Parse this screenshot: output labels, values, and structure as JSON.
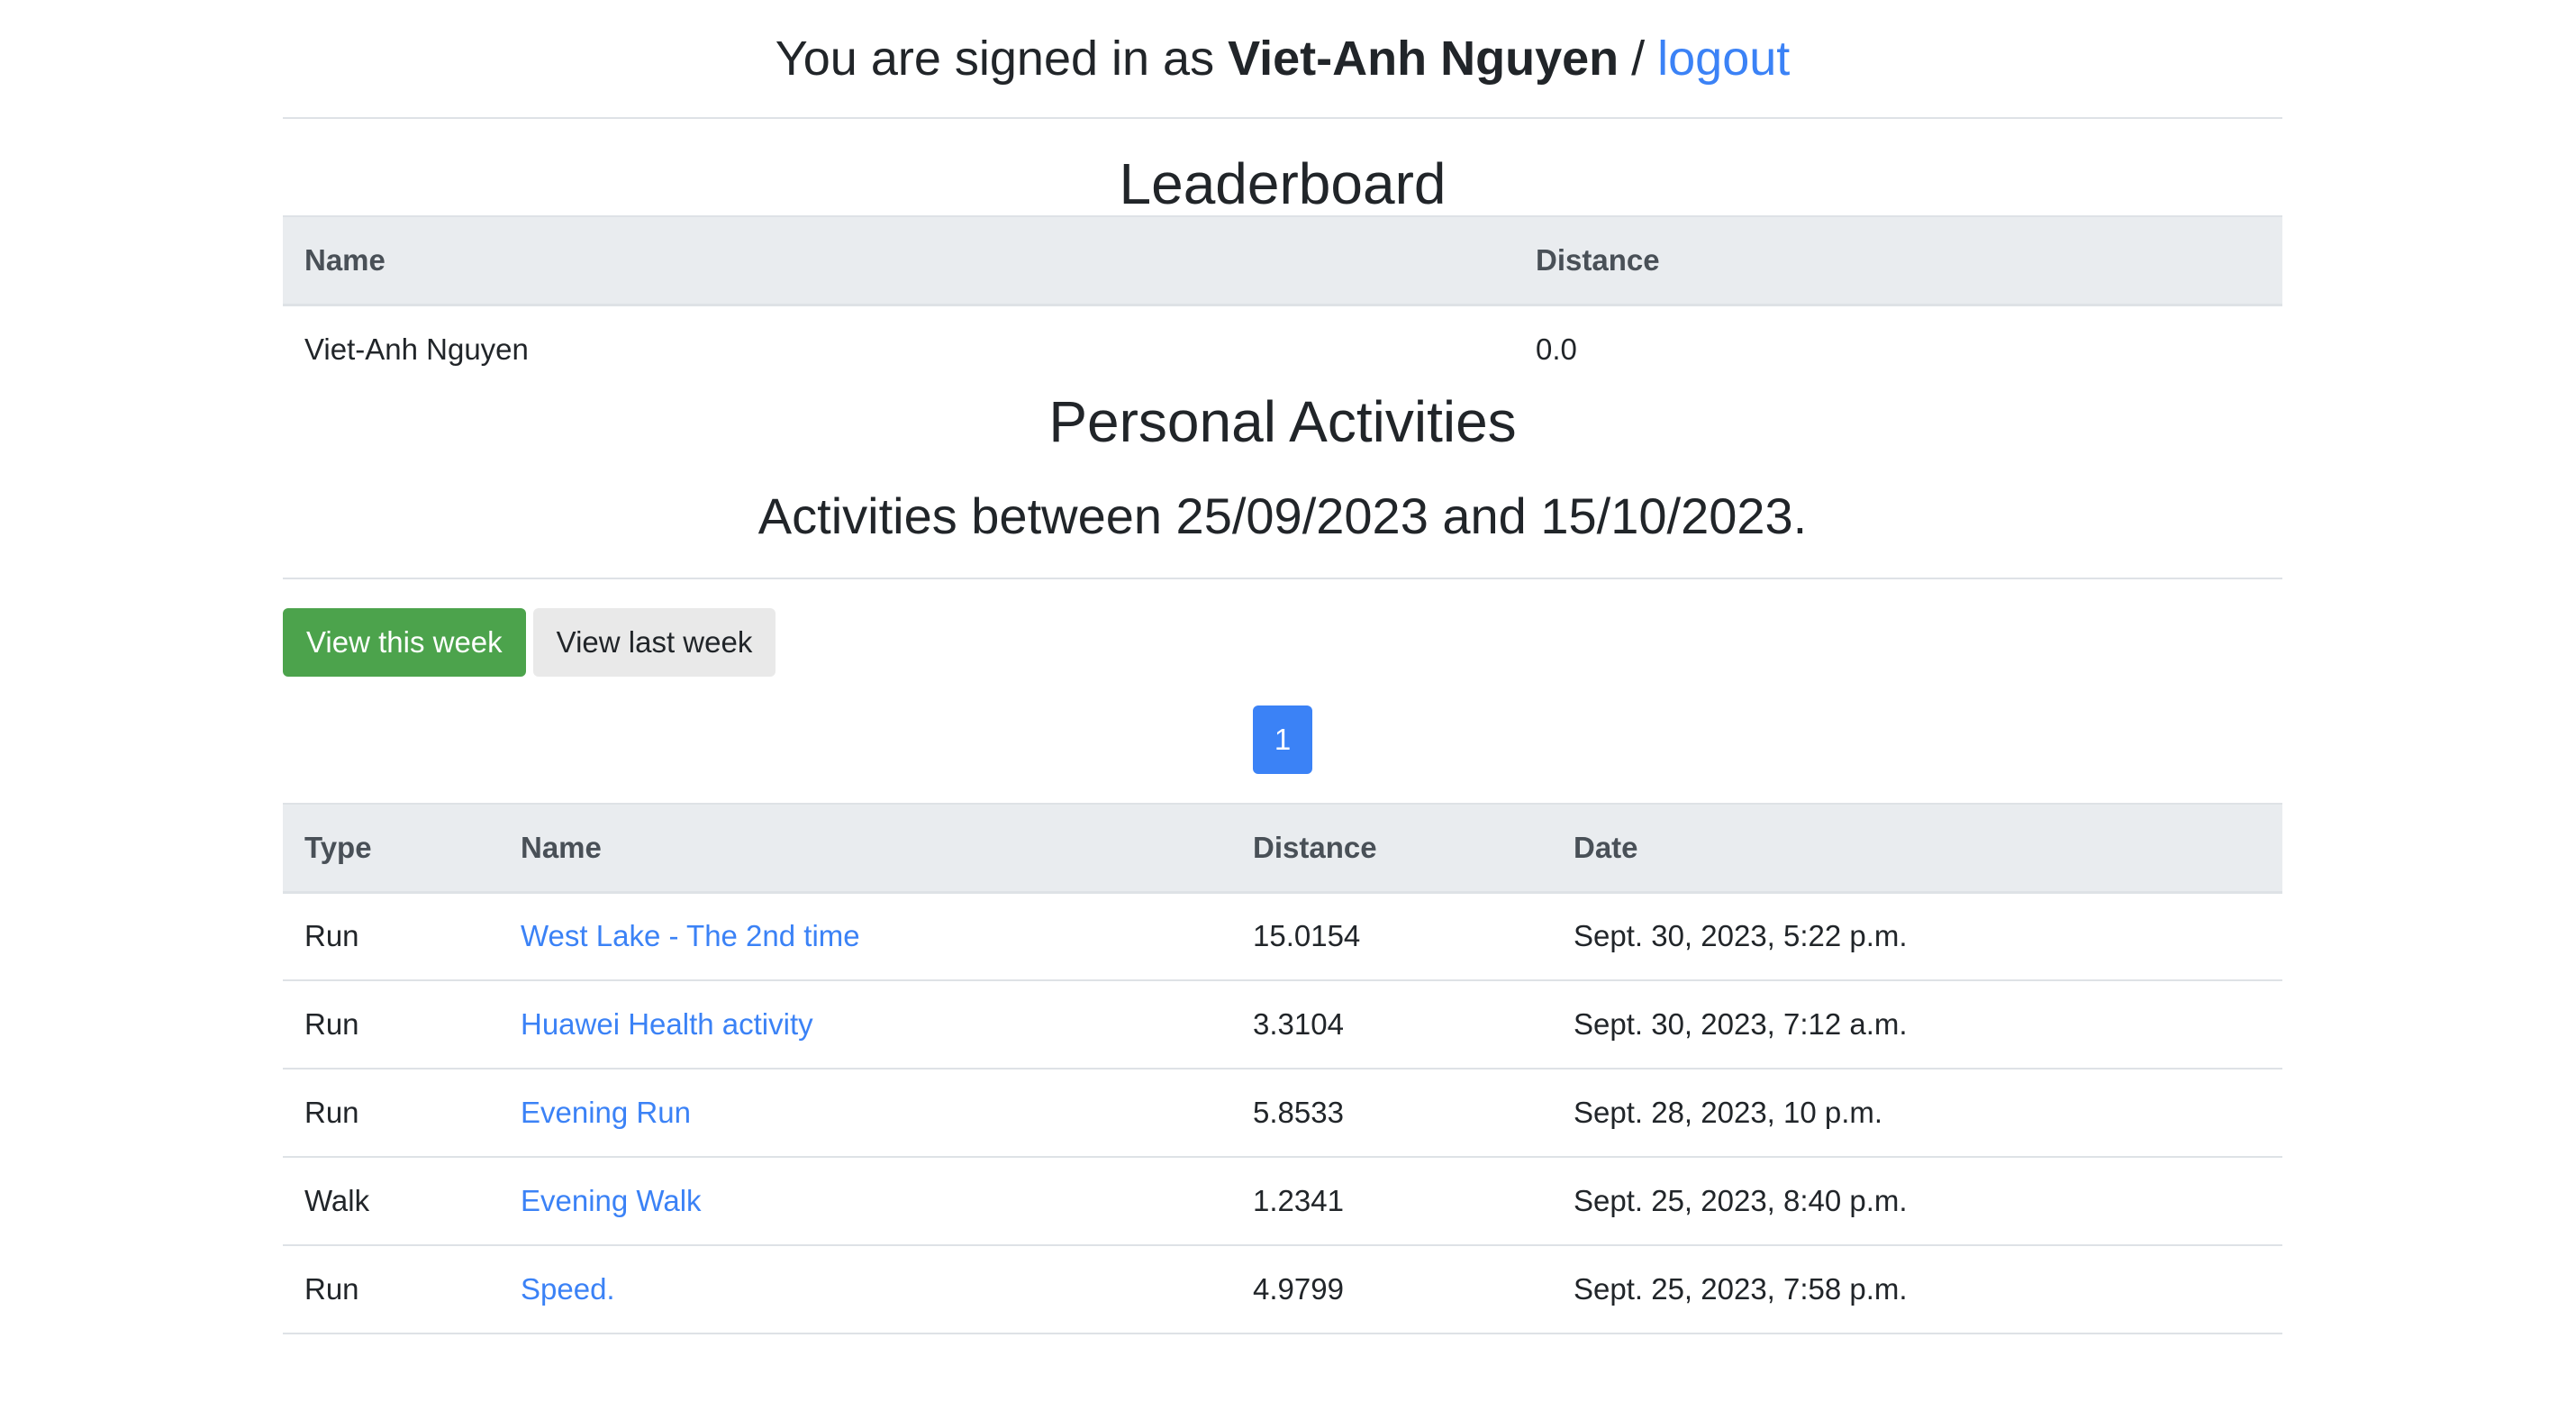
{
  "header": {
    "signed_in_prefix": "You are signed in as",
    "username": "Viet-Anh Nguyen",
    "separator": "/",
    "logout_label": "logout"
  },
  "leaderboard": {
    "title": "Leaderboard",
    "columns": [
      "Name",
      "Distance"
    ],
    "rows": [
      {
        "name": "Viet-Anh Nguyen",
        "distance": "0.0"
      }
    ]
  },
  "personal": {
    "title": "Personal Activities",
    "range_text": "Activities between 25/09/2023 and 15/10/2023.",
    "buttons": {
      "this_week": "View this week",
      "last_week": "View last week"
    },
    "pagination": {
      "current_page": "1"
    },
    "columns": [
      "Type",
      "Name",
      "Distance",
      "Date"
    ],
    "rows": [
      {
        "type": "Run",
        "name": "West Lake - The 2nd time",
        "distance": "15.0154",
        "date": "Sept. 30, 2023, 5:22 p.m."
      },
      {
        "type": "Run",
        "name": "Huawei Health activity",
        "distance": "3.3104",
        "date": "Sept. 30, 2023, 7:12 a.m."
      },
      {
        "type": "Run",
        "name": "Evening Run",
        "distance": "5.8533",
        "date": "Sept. 28, 2023, 10 p.m."
      },
      {
        "type": "Walk",
        "name": "Evening Walk",
        "distance": "1.2341",
        "date": "Sept. 25, 2023, 8:40 p.m."
      },
      {
        "type": "Run",
        "name": "Speed.",
        "distance": "4.9799",
        "date": "Sept. 25, 2023, 7:58 p.m."
      }
    ]
  },
  "colors": {
    "link": "#3b82f6",
    "primary_button": "#4ca34c",
    "secondary_button": "#e9e9e9",
    "page_button": "#3b82f6",
    "table_header_bg": "#e9ecef"
  }
}
